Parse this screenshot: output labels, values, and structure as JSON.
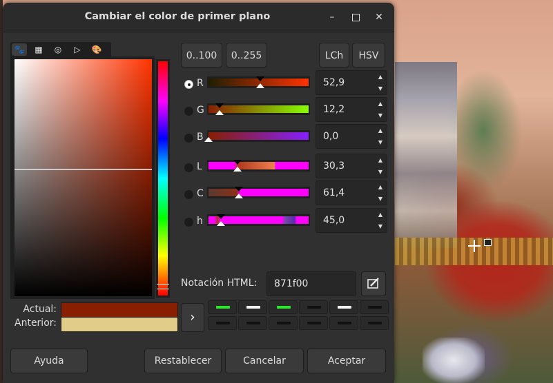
{
  "window": {
    "title": "Cambiar el color de primer plano",
    "minimize_icon": "–",
    "close_icon": "✕"
  },
  "tabs": [
    {
      "name": "gimp-selector-icon",
      "glyph": "🐾"
    },
    {
      "name": "cmyk-selector-icon",
      "glyph": "▦"
    },
    {
      "name": "wheel-selector-icon",
      "glyph": "◎"
    },
    {
      "name": "triangle-selector-icon",
      "glyph": "▷"
    },
    {
      "name": "palette-selector-icon",
      "glyph": "🎨"
    }
  ],
  "range_buttons": {
    "b100": "0..100",
    "b255": "0..255"
  },
  "space_buttons": {
    "lch": "LCh",
    "hsv": "HSV"
  },
  "channels": [
    {
      "label": "R",
      "value": "52,9",
      "selected": true
    },
    {
      "label": "G",
      "value": "12,2",
      "selected": false
    },
    {
      "label": "B",
      "value": "0,0",
      "selected": false
    },
    {
      "label": "L",
      "value": "30,3",
      "selected": false
    },
    {
      "label": "C",
      "value": "61,4",
      "selected": false
    },
    {
      "label": "h",
      "value": "45,0",
      "selected": false
    }
  ],
  "html_notation": {
    "label": "Notación HTML:",
    "value": "871f00"
  },
  "compare": {
    "actual_label": "Actual:",
    "anterior_label": "Anterior:",
    "actual_color": "#871f00",
    "anterior_color": "#e2cc8a"
  },
  "history": {
    "arrow": "›"
  },
  "buttons": {
    "help": "Ayuda",
    "reset": "Restablecer",
    "cancel": "Cancelar",
    "accept": "Aceptar"
  },
  "colors": {
    "accent_green": "#2ee82e",
    "dialog_bg": "#303030"
  }
}
